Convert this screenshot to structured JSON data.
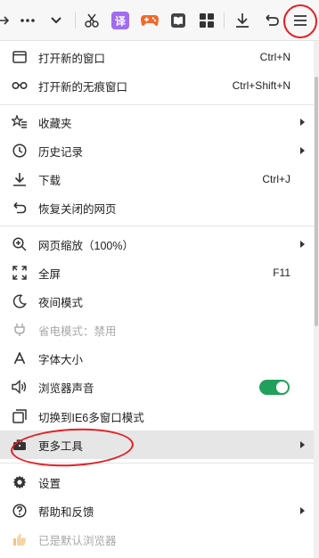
{
  "toolbar": {
    "icons": [
      "arrow-icon",
      "more-icon",
      "chevron-down-icon",
      "scissors-icon",
      "translate-icon",
      "game-icon",
      "reader-icon",
      "apps-icon",
      "download-icon",
      "undo-icon",
      "menu-icon"
    ],
    "translate_glyph": "译"
  },
  "menu": {
    "new_window": {
      "label": "打开新的窗口",
      "shortcut": "Ctrl+N"
    },
    "new_private_window": {
      "label": "打开新的无痕窗口",
      "shortcut": "Ctrl+Shift+N"
    },
    "bookmarks": {
      "label": "收藏夹"
    },
    "history": {
      "label": "历史记录"
    },
    "downloads": {
      "label": "下载",
      "shortcut": "Ctrl+J"
    },
    "restore_closed": {
      "label": "恢复关闭的网页"
    },
    "zoom": {
      "label": "网页缩放（100%）"
    },
    "fullscreen": {
      "label": "全屏",
      "shortcut": "F11"
    },
    "night_mode": {
      "label": "夜间模式"
    },
    "power_saver": {
      "label": "省电模式：禁用"
    },
    "font_size": {
      "label": "字体大小"
    },
    "browser_sound": {
      "label": "浏览器声音",
      "enabled": true
    },
    "ie6_mode": {
      "label": "切换到IE6多窗口模式"
    },
    "more_tools": {
      "label": "更多工具"
    },
    "settings": {
      "label": "设置"
    },
    "help": {
      "label": "帮助和反馈"
    },
    "default_browser": {
      "label": "已是默认浏览器"
    }
  },
  "colors": {
    "toggle_on": "#21a05b",
    "annotation_red": "#e31e24",
    "hover_bg": "#e6e6e6",
    "disabled_text": "#a8a8a8"
  }
}
